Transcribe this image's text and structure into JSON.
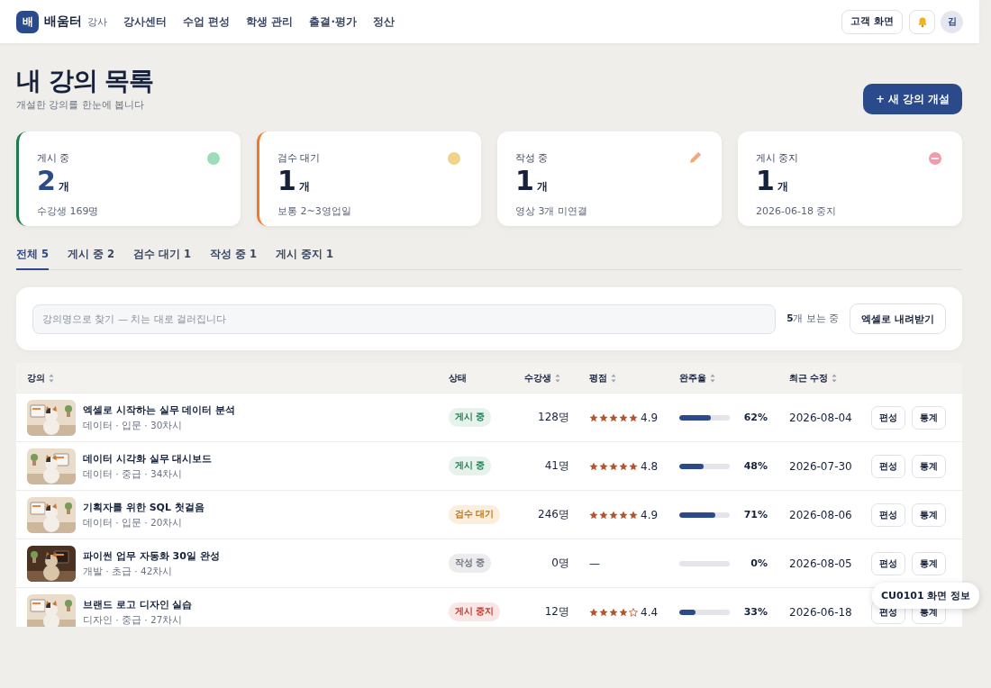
{
  "header": {
    "logo_mark": "배",
    "brand": "배움터",
    "role": "강사",
    "nav": [
      "강사센터",
      "수업 편성",
      "학생 관리",
      "출결·평가",
      "정산"
    ],
    "customer_view_button": "고객 화면",
    "avatar": "김"
  },
  "page": {
    "title": "내 강의 목록",
    "subtitle": "개설한 강의를 한눈에 봅니다",
    "new_button": "+ 새 강의 개설"
  },
  "stats": [
    {
      "kind": "published",
      "label": "게시 중",
      "value": "2",
      "unit": "개",
      "note": "수강생 169명"
    },
    {
      "kind": "review",
      "label": "검수 대기",
      "value": "1",
      "unit": "개",
      "note": "보통 2~3영업일"
    },
    {
      "kind": "draft",
      "label": "작성 중",
      "value": "1",
      "unit": "개",
      "note": "영상 3개 미연결"
    },
    {
      "kind": "stopped",
      "label": "게시 중지",
      "value": "1",
      "unit": "개",
      "note": "2026-06-18 중지"
    }
  ],
  "tabs": [
    {
      "label": "전체 5",
      "selected": true
    },
    {
      "label": "게시 중 2",
      "selected": false
    },
    {
      "label": "검수 대기 1",
      "selected": false
    },
    {
      "label": "작성 중 1",
      "selected": false
    },
    {
      "label": "게시 중지 1",
      "selected": false
    }
  ],
  "search": {
    "placeholder": "강의명으로 찾기 — 치는 대로 걸러집니다",
    "count": "**5**개 보는 중",
    "export_button": "엑셀로 내려받기"
  },
  "table": {
    "columns": [
      {
        "label": "강의",
        "sortable": true
      },
      {
        "label": "상태",
        "sortable": false
      },
      {
        "label": "수강생",
        "sortable": true
      },
      {
        "label": "평점",
        "sortable": true
      },
      {
        "label": "완주율",
        "sortable": true
      },
      {
        "label": "최근 수정",
        "sortable": true
      }
    ],
    "rows": [
      {
        "title": "엑셀로 시작하는 실무 데이터 분석",
        "meta": "데이터 · 입문 · 30차시",
        "status": {
          "kind": "published",
          "label": "게시 중"
        },
        "students": "128명",
        "stars": 5,
        "rating": "4.9",
        "completion": {
          "level": 0.62,
          "label": "62%"
        },
        "updated": "2026-08-04",
        "actions": [
          "편성",
          "통계"
        ]
      },
      {
        "title": "데이터 시각화 실무 대시보드",
        "meta": "데이터 · 중급 · 34차시",
        "status": {
          "kind": "published",
          "label": "게시 중"
        },
        "students": "41명",
        "stars": 5,
        "rating": "4.8",
        "completion": {
          "level": 0.48,
          "label": "48%"
        },
        "updated": "2026-07-30",
        "actions": [
          "편성",
          "통계"
        ]
      },
      {
        "title": "기획자를 위한 SQL 첫걸음",
        "meta": "데이터 · 입문 · 20차시",
        "status": {
          "kind": "review",
          "label": "검수 대기"
        },
        "students": "246명",
        "stars": 5,
        "rating": "4.9",
        "completion": {
          "level": 0.71,
          "label": "71%"
        },
        "updated": "2026-08-06",
        "actions": [
          "편성",
          "통계"
        ]
      },
      {
        "title": "파이썬 업무 자동화 30일 완성",
        "meta": "개발 · 초급 · 42차시",
        "status": {
          "kind": "draft",
          "label": "작성 중"
        },
        "students": "0명",
        "rating": "—",
        "completion": {
          "level": 0,
          "label": "0%"
        },
        "updated": "2026-08-05",
        "actions": [
          "편성",
          "통계"
        ]
      },
      {
        "title": "브랜드 로고 디자인 실습",
        "meta": "디자인 · 중급 · 27차시",
        "status": {
          "kind": "stopped",
          "label": "게시 중지"
        },
        "students": "12명",
        "stars": 4,
        "rating": "4.4",
        "completion": {
          "level": 0.33,
          "label": "33%"
        },
        "updated": "2026-06-18",
        "actions": [
          "편성",
          "통계"
        ]
      }
    ]
  },
  "tooltip": "CU0101 화면 정보"
}
